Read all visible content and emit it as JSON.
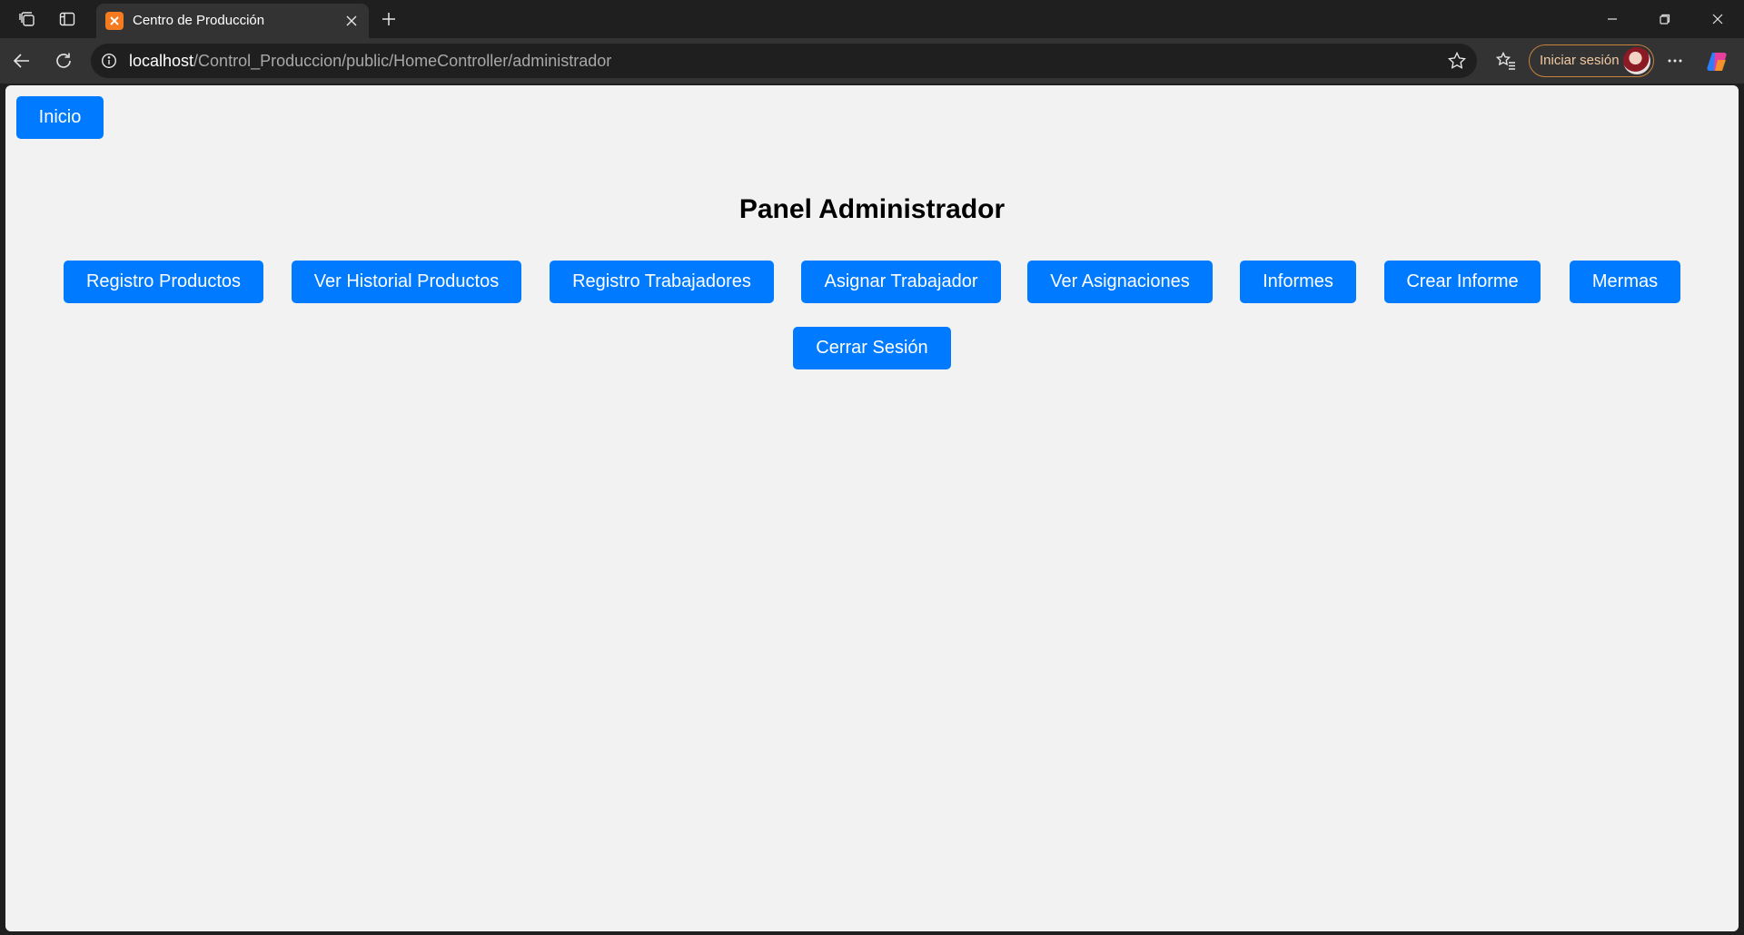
{
  "browser": {
    "tab": {
      "title": "Centro de Producción"
    },
    "url": {
      "host": "localhost",
      "path": "/Control_Produccion/public/HomeController/administrador"
    },
    "signin_label": "Iniciar sesión",
    "icons": [
      "workspaces-icon",
      "vertical-tabs-icon",
      "xampp-favicon-icon",
      "close-icon",
      "new-tab-icon",
      "minimize-icon",
      "restore-icon",
      "window-close-icon",
      "back-icon",
      "reload-icon",
      "site-info-icon",
      "favorite-star-icon",
      "favorites-icon",
      "more-icon",
      "copilot-icon"
    ]
  },
  "page": {
    "home_button": "Inicio",
    "title": "Panel Administrador",
    "menu": [
      "Registro Productos",
      "Ver Historial Productos",
      "Registro Trabajadores",
      "Asignar Trabajador",
      "Ver Asignaciones",
      "Informes",
      "Crear Informe",
      "Mermas"
    ],
    "logout_button": "Cerrar Sesión",
    "colors": {
      "button": "#007bff",
      "background": "#f2f2f2"
    }
  }
}
